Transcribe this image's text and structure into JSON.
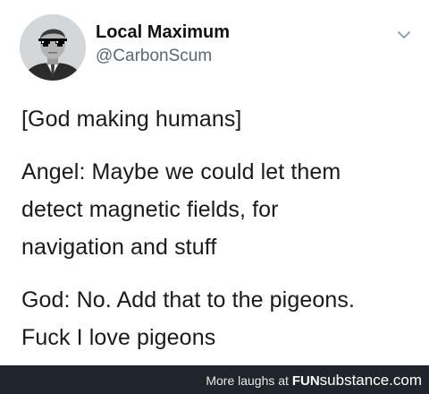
{
  "tweet": {
    "display_name": "Local Maximum",
    "handle": "@CarbonScum",
    "avatar_icon": "profile-photo-with-pixel-sunglasses",
    "menu_icon": "chevron-down-icon",
    "lines": [
      "[God making humans]",
      "Angel: Maybe we could let them",
      "detect magnetic fields, for",
      "navigation and stuff",
      "God: No. Add that to the pigeons.",
      "Fuck I love pigeons"
    ]
  },
  "footer": {
    "prefix": "More laughs at ",
    "brand_bold": "FUN",
    "brand_rest": "substance",
    "brand_suffix": ".com"
  },
  "colors": {
    "text": "#1a1a1a",
    "handle": "#5b6670",
    "footer_bg": "#20252b",
    "footer_text": "#ffffff"
  }
}
